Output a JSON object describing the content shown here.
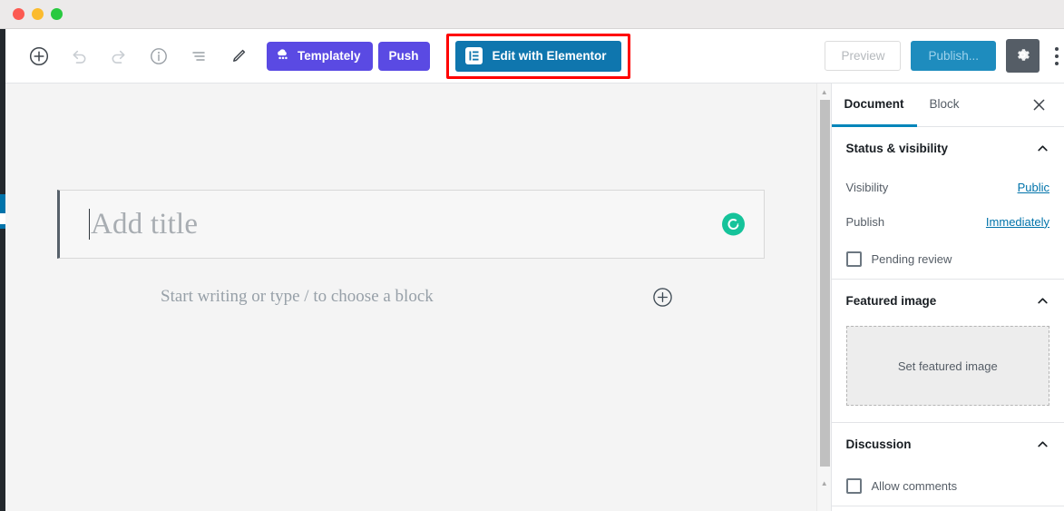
{
  "window": {
    "traffic_lights": [
      "close",
      "minimize",
      "maximize"
    ]
  },
  "toolbar": {
    "icons": [
      {
        "name": "add-block-icon",
        "label": "Add block"
      },
      {
        "name": "undo-icon",
        "label": "Undo"
      },
      {
        "name": "redo-icon",
        "label": "Redo"
      },
      {
        "name": "content-info-icon",
        "label": "Content structure"
      },
      {
        "name": "block-navigation-icon",
        "label": "Block navigation"
      },
      {
        "name": "edit-pencil-icon",
        "label": "Edit"
      }
    ],
    "templately_label": "Templately",
    "push_label": "Push",
    "elementor_label": "Edit with Elementor",
    "preview_label": "Preview",
    "publish_label": "Publish...",
    "settings_label": "Settings",
    "more_label": "More tools & options"
  },
  "editor": {
    "title_placeholder": "Add title",
    "paragraph_placeholder": "Start writing or type / to choose a block",
    "grammarly_badge": "G"
  },
  "sidebar": {
    "tabs": [
      {
        "label": "Document",
        "active": true
      },
      {
        "label": "Block",
        "active": false
      }
    ],
    "close_label": "Close settings",
    "panels": [
      {
        "title": "Status & visibility",
        "rows": [
          {
            "label": "Visibility",
            "value": "Public"
          },
          {
            "label": "Publish",
            "value": "Immediately"
          }
        ],
        "checkbox": {
          "label": "Pending review",
          "checked": false
        }
      },
      {
        "title": "Featured image",
        "dropzone_label": "Set featured image"
      },
      {
        "title": "Discussion",
        "checkbox": {
          "label": "Allow comments",
          "checked": false
        }
      }
    ]
  },
  "colors": {
    "templately_purple": "#5a4ae3",
    "elementor_blue": "#0f76ae",
    "highlight_red": "#ff0000",
    "publish_blue": "#1e8cbe",
    "link_blue": "#0073aa",
    "grammarly_green": "#15c39a",
    "wp_admin_dark": "#23282d"
  }
}
